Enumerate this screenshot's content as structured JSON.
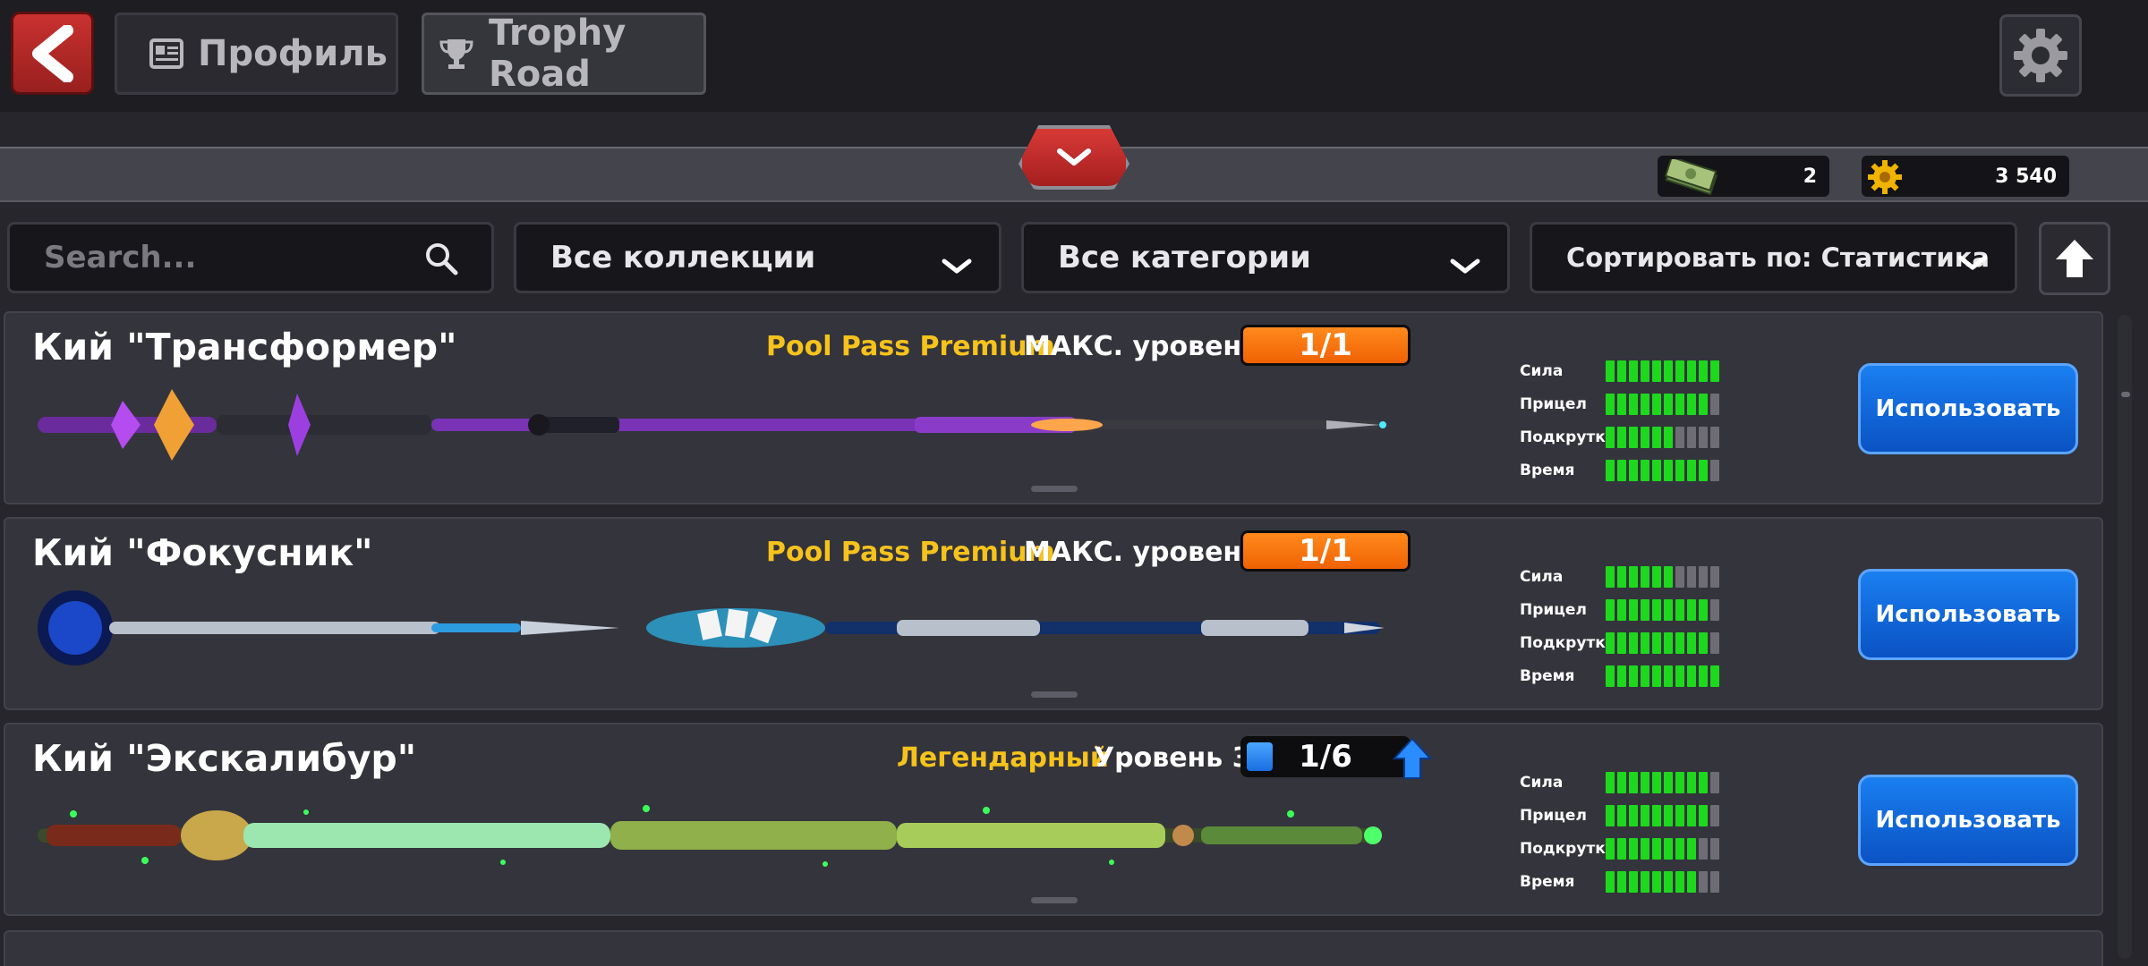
{
  "header": {
    "back_icon": "chevron-left-icon",
    "tabs": [
      {
        "label": "Профиль",
        "icon": "profile-card-icon"
      },
      {
        "label": "Trophy Road",
        "icon": "trophy-icon"
      }
    ],
    "settings_icon": "gear-icon"
  },
  "currency": {
    "cash": "2",
    "coins": "3 540"
  },
  "filters": {
    "search_placeholder": "Search...",
    "collection": "Все коллекции",
    "category": "Все категории",
    "sort": "Сортировать по: Статистика"
  },
  "stat_labels": [
    "Сила",
    "Прицел",
    "Подкрутка",
    "Время"
  ],
  "cues": [
    {
      "name": "Кий \"Трансформер\"",
      "tier": "Pool Pass Premium",
      "level_label": "МАКС. уровень",
      "level_value": "1/1",
      "stats": [
        10,
        9,
        6,
        9
      ],
      "button": "Использовать"
    },
    {
      "name": "Кий \"Фокусник\"",
      "tier": "Pool Pass Premium",
      "level_label": "МАКС. уровень",
      "level_value": "1/1",
      "stats": [
        6,
        9,
        9,
        10
      ],
      "button": "Использовать"
    },
    {
      "name": "Кий \"Экскалибур\"",
      "tier": "Легендарный",
      "level_label": "Уровень 3",
      "level_value": "1/6",
      "level_progress": 0.1667,
      "stats": [
        9,
        9,
        8,
        8
      ],
      "button": "Использовать"
    }
  ]
}
